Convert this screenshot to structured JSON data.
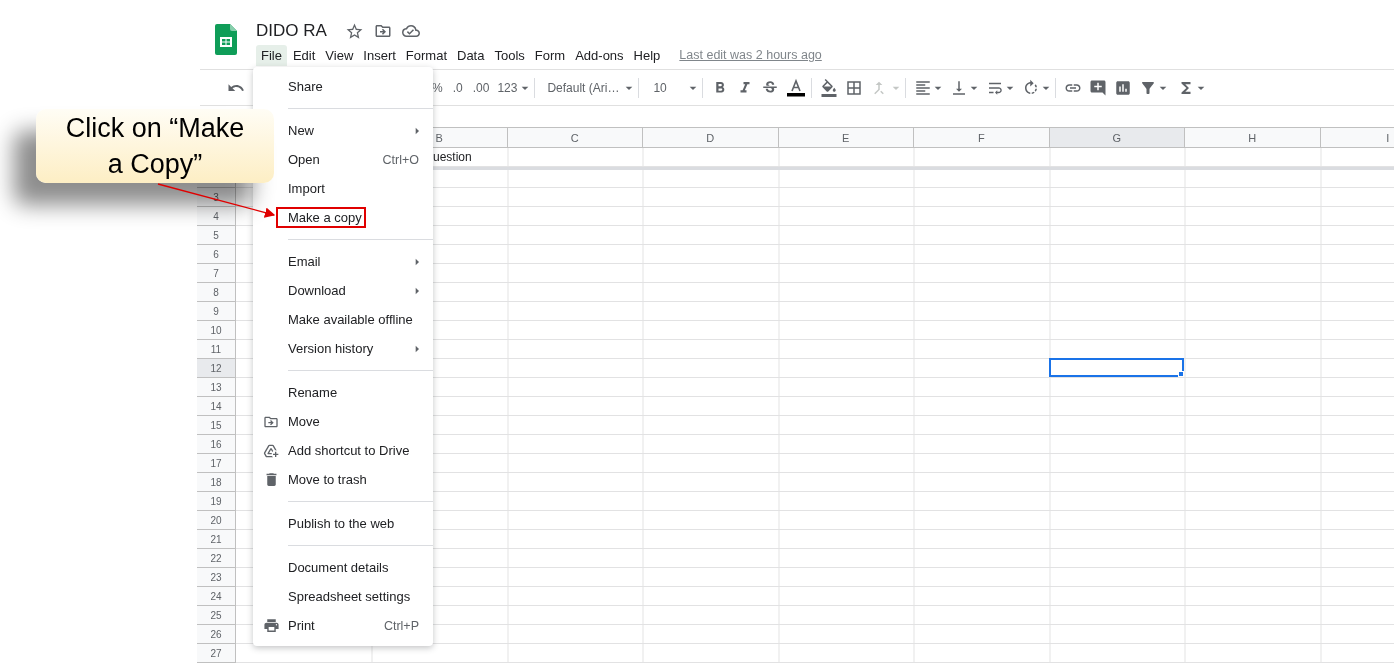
{
  "app": {
    "title": "DIDO RA",
    "menus": [
      {
        "label": "File",
        "selected": true
      },
      {
        "label": "Edit",
        "selected": false
      },
      {
        "label": "View",
        "selected": false
      },
      {
        "label": "Insert",
        "selected": false
      },
      {
        "label": "Format",
        "selected": false
      },
      {
        "label": "Data",
        "selected": false
      },
      {
        "label": "Tools",
        "selected": false
      },
      {
        "label": "Form",
        "selected": false
      },
      {
        "label": "Add-ons",
        "selected": false
      },
      {
        "label": "Help",
        "selected": false
      }
    ],
    "last_edit": "Last edit was 2 hours ago"
  },
  "toolbar": {
    "percent": "%",
    "decrease_decimals": ".0",
    "increase_decimals": ".00",
    "number_format": "123",
    "font": "Default (Ari…",
    "font_size": "10",
    "merge_disabled": true
  },
  "file_menu": {
    "sections": [
      [
        {
          "label": "Share",
          "kind": "plain"
        }
      ],
      [
        {
          "label": "New",
          "kind": "plain",
          "submenu": true
        },
        {
          "label": "Open",
          "kind": "plain",
          "shortcut": "Ctrl+O"
        },
        {
          "label": "Import",
          "kind": "plain"
        },
        {
          "label": "Make a copy",
          "kind": "plain",
          "highlighted": true
        }
      ],
      [
        {
          "label": "Email",
          "kind": "plain",
          "submenu": true
        },
        {
          "label": "Download",
          "kind": "plain",
          "submenu": true
        },
        {
          "label": "Make available offline",
          "kind": "plain"
        },
        {
          "label": "Version history",
          "kind": "plain",
          "submenu": true
        }
      ],
      [
        {
          "label": "Rename",
          "kind": "plain"
        },
        {
          "label": "Move",
          "kind": "move"
        },
        {
          "label": "Add shortcut to Drive",
          "kind": "shortcut"
        },
        {
          "label": "Move to trash",
          "kind": "trash"
        }
      ],
      [
        {
          "label": "Publish to the web",
          "kind": "plain"
        }
      ],
      [
        {
          "label": "Document details",
          "kind": "plain"
        },
        {
          "label": "Spreadsheet settings",
          "kind": "plain"
        },
        {
          "label": "Print",
          "kind": "print",
          "shortcut": "Ctrl+P"
        }
      ]
    ]
  },
  "sheet": {
    "columns": [
      {
        "label": "B",
        "selected": false
      },
      {
        "label": "C",
        "selected": false
      },
      {
        "label": "D",
        "selected": false
      },
      {
        "label": "E",
        "selected": false
      },
      {
        "label": "F",
        "selected": false
      },
      {
        "label": "G",
        "selected": true
      },
      {
        "label": "H",
        "selected": false
      },
      {
        "label": "I",
        "selected": false
      }
    ],
    "first_row": {
      "column_b": "uestion"
    },
    "rows": [
      {
        "number": "3",
        "selected": false
      },
      {
        "number": "4",
        "selected": false
      },
      {
        "number": "5",
        "selected": false
      },
      {
        "number": "6",
        "selected": false
      },
      {
        "number": "7",
        "selected": false
      },
      {
        "number": "8",
        "selected": false
      },
      {
        "number": "9",
        "selected": false
      },
      {
        "number": "10",
        "selected": false
      },
      {
        "number": "11",
        "selected": false
      },
      {
        "number": "12",
        "selected": true
      },
      {
        "number": "13",
        "selected": false
      },
      {
        "number": "14",
        "selected": false
      },
      {
        "number": "15",
        "selected": false
      },
      {
        "number": "16",
        "selected": false
      },
      {
        "number": "17",
        "selected": false
      },
      {
        "number": "18",
        "selected": false
      },
      {
        "number": "19",
        "selected": false
      },
      {
        "number": "20",
        "selected": false
      },
      {
        "number": "21",
        "selected": false
      },
      {
        "number": "22",
        "selected": false
      },
      {
        "number": "23",
        "selected": false
      },
      {
        "number": "24",
        "selected": false
      },
      {
        "number": "25",
        "selected": false
      },
      {
        "number": "26",
        "selected": false
      },
      {
        "number": "27",
        "selected": false
      }
    ]
  },
  "callout": {
    "text": "Click on “Make a Copy”"
  }
}
